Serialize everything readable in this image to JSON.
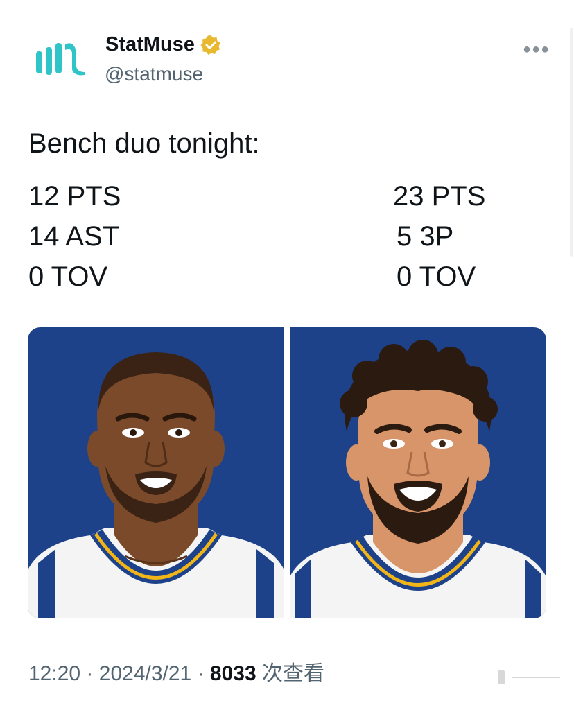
{
  "account": {
    "display_name": "StatMuse",
    "handle": "@statmuse",
    "verified": true
  },
  "tweet": {
    "text": "Bench duo tonight:",
    "player_left_stats": [
      "12 PTS",
      "14 AST",
      "0 TOV"
    ],
    "player_right_stats": [
      "23 PTS",
      "5 3P",
      "0 TOV"
    ]
  },
  "meta": {
    "time": "12:20",
    "separator": "·",
    "date": "2024/3/21",
    "views_count": "8033",
    "views_label": "次查看"
  },
  "icons": {
    "logo": "statmuse-logo-icon",
    "verified": "verified-badge-icon",
    "more": "more-options-icon"
  },
  "colors": {
    "logo_teal": "#2fc4c8",
    "verified_gold": "#e8b82e",
    "card_background": "#1d428a",
    "jersey_gold": "#f2b518"
  }
}
